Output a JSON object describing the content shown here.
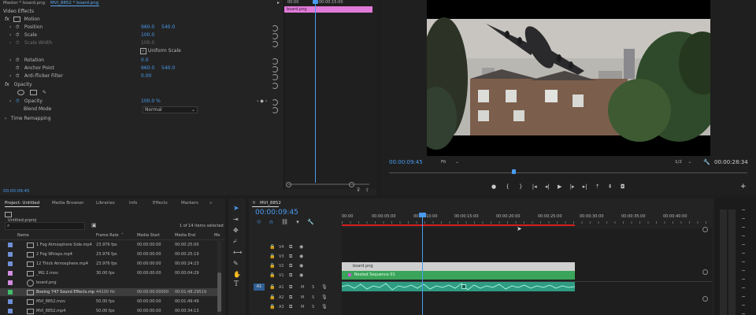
{
  "effect_controls": {
    "tabs": [
      "Master * board.png",
      "MVI_8852 * board.png"
    ],
    "section": "Video Effects",
    "motion_label": "Motion",
    "position_label": "Position",
    "position_x": "960.0",
    "position_y": "540.0",
    "scale_label": "Scale",
    "scale_value": "100.0",
    "scale_width_label": "Scale Width",
    "scale_width_value": "100.0",
    "uniform_scale_label": "Uniform Scale",
    "rotation_label": "Rotation",
    "rotation_value": "0.0",
    "anchor_label": "Anchor Point",
    "anchor_x": "960.0",
    "anchor_y": "540.0",
    "antiflicker_label": "Anti-flicker Filter",
    "antiflicker_value": "0.00",
    "opacity_section": "Opacity",
    "opacity_label": "Opacity",
    "opacity_value": "100.0 %",
    "blend_label": "Blend Mode",
    "blend_value": "Normal",
    "time_remap_label": "Time Remapping",
    "mini_timeline": {
      "t0": "00:00",
      "t1": "00:00:15:00",
      "clip_label": "board.png"
    },
    "current_time": "00:00:09:45"
  },
  "program_monitor": {
    "timecode": "00:00:09:45",
    "fit_label": "Fit",
    "resolution": "1/2",
    "duration": "00:00:28:34"
  },
  "project": {
    "tabs": [
      "Project: Untitled",
      "Media Browser",
      "Libraries",
      "Info",
      "Effects",
      "Markers"
    ],
    "more": "»",
    "filename": "Untitled.prproj",
    "selection_info": "1 of 14 items selected",
    "columns": [
      "Name",
      "Frame Rate",
      "Media Start",
      "Media End",
      "Me"
    ],
    "items": [
      {
        "name": "1 Fog Atmosphere Side.mp4",
        "rate": "23.976 fps",
        "start": "00:00:00:00",
        "end": "00:00:25:00",
        "color": "#6f8fd6",
        "kind": "video"
      },
      {
        "name": "2 Fog Whisps.mp4",
        "rate": "23.976 fps",
        "start": "00:00:00:00",
        "end": "00:00:25:19",
        "color": "#6f8fd6",
        "kind": "video"
      },
      {
        "name": "12 Thick Atmosphere.mp4",
        "rate": "23.976 fps",
        "start": "00:00:00:00",
        "end": "00:00:24:23",
        "color": "#6f8fd6",
        "kind": "video"
      },
      {
        "name": "_MG 2.mov",
        "rate": "30.00 fps",
        "start": "00:00:00:00",
        "end": "00:00:04:29",
        "color": "#d28ce0",
        "kind": "video"
      },
      {
        "name": "board.png",
        "rate": "",
        "start": "",
        "end": "",
        "color": "#d28ce0",
        "kind": "still"
      },
      {
        "name": "Boeing 747 Sound Effects.mp",
        "rate": "44100 Hz",
        "start": "00:00:00:00000",
        "end": "00:01:48:29519",
        "color": "#3fbf6a",
        "kind": "audio",
        "selected": true
      },
      {
        "name": "MVI_8852.mov",
        "rate": "50.00 fps",
        "start": "00:00:00:00",
        "end": "00:01:49:49",
        "color": "#6f8fd6",
        "kind": "video"
      },
      {
        "name": "MVI_8852.mp4",
        "rate": "50.00 fps",
        "start": "00:00:00:00",
        "end": "00:00:34:13",
        "color": "#6f8fd6",
        "kind": "video"
      }
    ]
  },
  "timeline": {
    "tab": "MVI_8852",
    "timecode": "00:00:09:45",
    "ruler": [
      "00:00",
      "00:00:05:00",
      "00:00:10:00",
      "00:00:15:00",
      "00:00:20:00",
      "00:00:25:00",
      "00:00:30:00",
      "00:00:35:00",
      "00:00:40:00"
    ],
    "tracks": [
      "V4",
      "V3",
      "V2",
      "V1",
      "A1",
      "A2",
      "A3"
    ],
    "source_patch": "A1",
    "clips": {
      "v2": "board.png",
      "v1": "Nested Sequence 01"
    },
    "track_button_labels": {
      "mute": "M",
      "solo": "S"
    }
  },
  "colors": {
    "accent": "#4a9cf0",
    "clip_pink": "#d87bd0",
    "clip_green": "#3aa55a",
    "audio_green": "#2f9b82",
    "playhead": "#4a9cf0",
    "work_area": "#d62020"
  }
}
